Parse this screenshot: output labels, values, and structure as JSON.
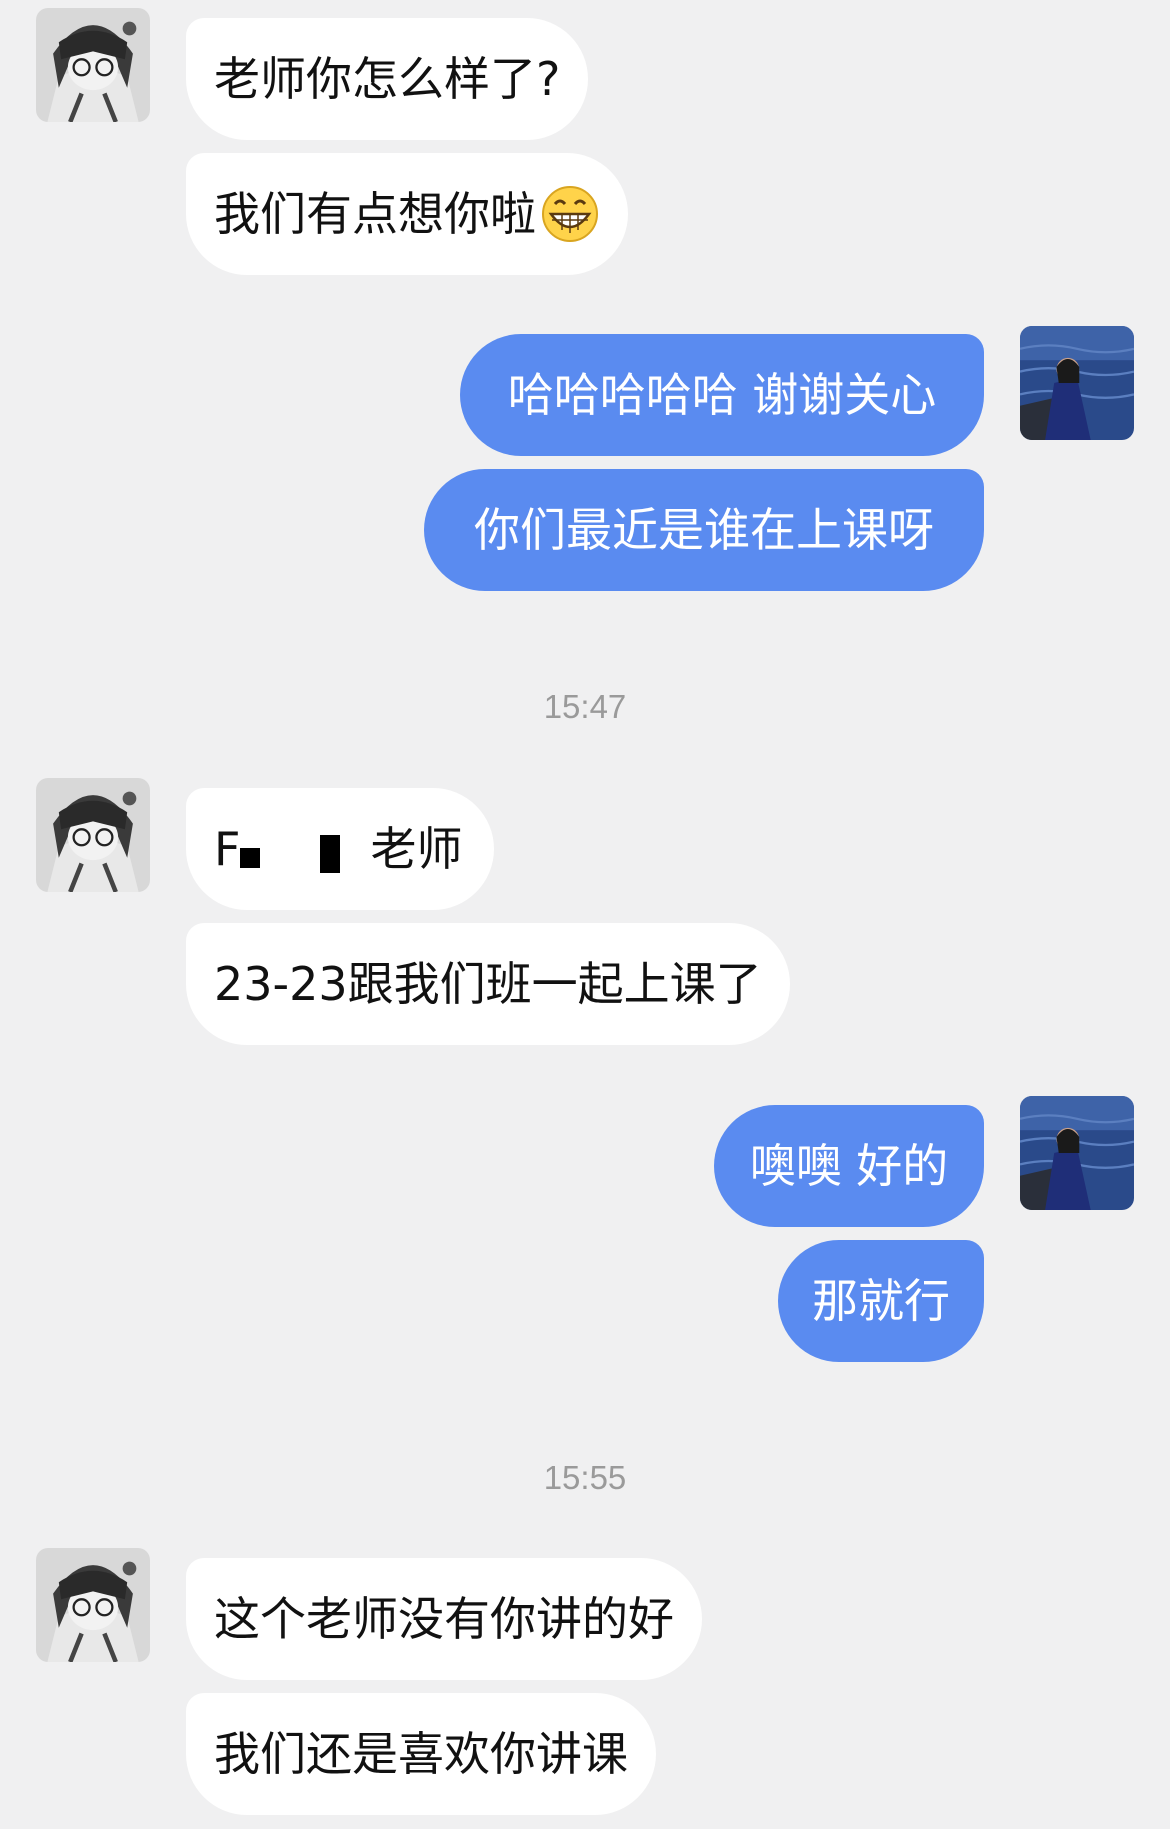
{
  "chat": {
    "time_1": "15:47",
    "time_2": "15:55",
    "messages": [
      {
        "text": "老师你怎么样了?"
      },
      {
        "text": "我们有点想你啦",
        "emoji": "grinning-face"
      },
      {
        "text": "哈哈哈哈哈 谢谢关心"
      },
      {
        "text": "你们最近是谁在上课呀"
      },
      {
        "text_start": "F",
        "text_end": "老师",
        "redacted": true
      },
      {
        "text": "23-23跟我们班一起上课了"
      },
      {
        "text": "噢噢 好的"
      },
      {
        "text": "那就行"
      },
      {
        "text": "这个老师没有你讲的好"
      },
      {
        "text": "我们还是喜欢你讲课"
      }
    ]
  },
  "colors": {
    "background": "#f0f0f1",
    "incoming_bubble": "#ffffff",
    "outgoing_bubble": "#5a8bf0",
    "timestamp": "#9a9a9a"
  }
}
